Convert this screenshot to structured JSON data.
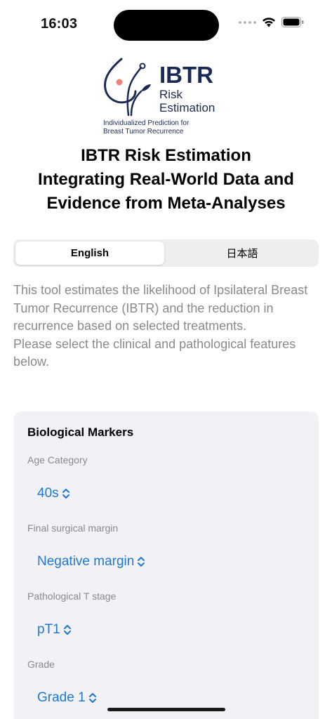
{
  "status_bar": {
    "time": "16:03"
  },
  "logo": {
    "title": "IBTR",
    "subtitle_line1": "Risk",
    "subtitle_line2": "Estimation",
    "tagline_line1": "Individualized Prediction for",
    "tagline_line2": "Breast Tumor Recurrence",
    "colors": {
      "navy": "#1b2a52",
      "coral": "#f0807a"
    }
  },
  "header": {
    "title_line1": "IBTR Risk Estimation",
    "title_line2": "Integrating Real-World Data and",
    "title_line3": "Evidence from Meta-Analyses"
  },
  "language": {
    "options": [
      "English",
      "日本語"
    ],
    "selected": "English"
  },
  "description": {
    "paragraph1": "This tool estimates the likelihood of Ipsilateral Breast Tumor Recurrence (IBTR) and the reduction in recurrence based on selected treatments.",
    "paragraph2": "Please select the clinical and pathological features below."
  },
  "biological_markers": {
    "heading": "Biological Markers",
    "fields": [
      {
        "label": "Age Category",
        "value": "40s"
      },
      {
        "label": "Final surgical margin",
        "value": "Negative margin"
      },
      {
        "label": "Pathological T stage",
        "value": "pT1"
      },
      {
        "label": "Grade",
        "value": "Grade 1"
      }
    ]
  },
  "icons": {
    "picker": "chevron-up-down-icon",
    "wifi": "wifi-icon",
    "battery": "battery-icon",
    "signal": "cellular-signal-icon"
  },
  "theme": {
    "accent": "#1f78d1",
    "secondary_text": "#8a8a8e",
    "card_background": "#f1f1f6"
  }
}
